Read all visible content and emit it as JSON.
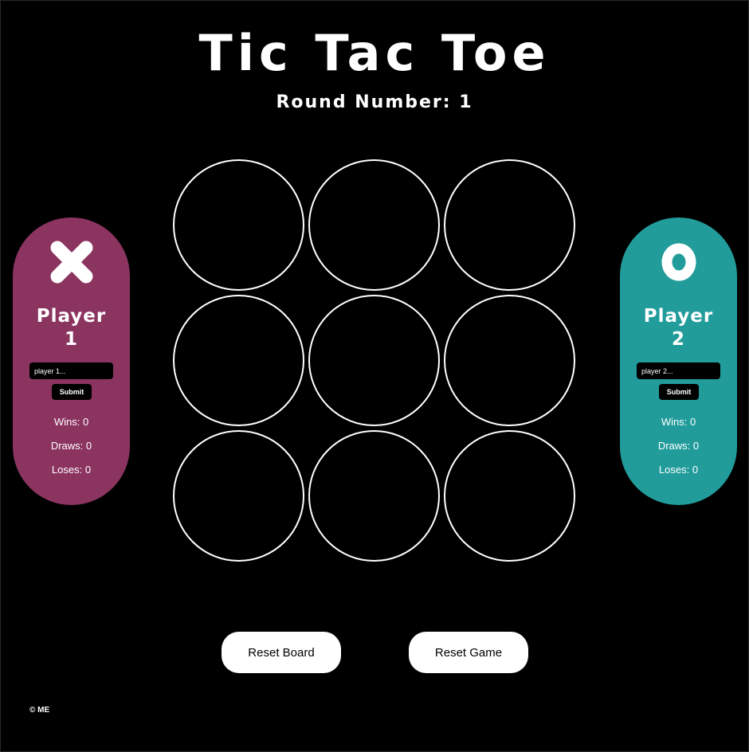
{
  "header": {
    "title": "Tic Tac Toe",
    "round_label": "Round Number: 1"
  },
  "board": {
    "cells": [
      "",
      "",
      "",
      "",
      "",
      "",
      "",
      "",
      ""
    ]
  },
  "players": [
    {
      "mark": "X",
      "name_line1": "Player",
      "name_line2": "1",
      "input_placeholder": "player 1...",
      "submit_label": "Submit",
      "wins": "Wins: 0",
      "draws": "Draws: 0",
      "loses": "Loses: 0",
      "color": "#8b3460"
    },
    {
      "mark": "O",
      "name_line1": "Player",
      "name_line2": "2",
      "input_placeholder": "player 2...",
      "submit_label": "Submit",
      "wins": "Wins: 0",
      "draws": "Draws: 0",
      "loses": "Loses: 0",
      "color": "#219c9b"
    }
  ],
  "controls": {
    "reset_board_label": "Reset Board",
    "reset_game_label": "Reset Game"
  },
  "footer": {
    "text": "© ME"
  },
  "colors": {
    "background": "#000000",
    "foreground": "#ffffff",
    "player1": "#8b3460",
    "player2": "#219c9b"
  }
}
